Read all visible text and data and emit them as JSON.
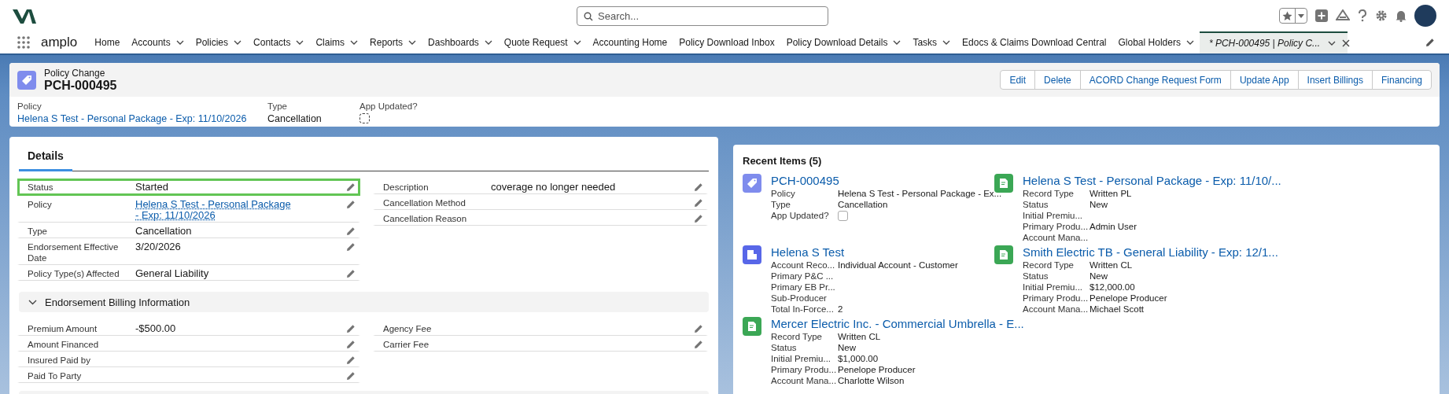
{
  "global_header": {
    "search": {
      "placeholder": "Search..."
    }
  },
  "nav": {
    "app_name": "amplo",
    "items": [
      {
        "label": "Home",
        "has_menu": false
      },
      {
        "label": "Accounts",
        "has_menu": true
      },
      {
        "label": "Policies",
        "has_menu": true
      },
      {
        "label": "Contacts",
        "has_menu": true
      },
      {
        "label": "Claims",
        "has_menu": true
      },
      {
        "label": "Reports",
        "has_menu": true
      },
      {
        "label": "Dashboards",
        "has_menu": true
      },
      {
        "label": "Quote Request",
        "has_menu": true
      },
      {
        "label": "Accounting Home",
        "has_menu": false
      },
      {
        "label": "Policy Download Inbox",
        "has_menu": false
      },
      {
        "label": "Policy Download Details",
        "has_menu": true
      },
      {
        "label": "Tasks",
        "has_menu": true
      },
      {
        "label": "Edocs & Claims Download Central",
        "has_menu": false
      },
      {
        "label": "Global Holders",
        "has_menu": true
      }
    ],
    "open_tab": {
      "label": "* PCH-000495 | Policy C...",
      "selected": true
    }
  },
  "record": {
    "object": "Policy Change",
    "name": "PCH-000495",
    "actions": [
      "Edit",
      "Delete",
      "ACORD Change Request Form",
      "Update App",
      "Insert Billings",
      "Financing"
    ],
    "highlights": [
      {
        "label": "Policy",
        "kind": "link",
        "value": "Helena S Test - Personal Package - Exp: 11/10/2026"
      },
      {
        "label": "Type",
        "kind": "text",
        "value": "Cancellation"
      },
      {
        "label": "App Updated?",
        "kind": "checkbox",
        "checked": false
      }
    ]
  },
  "details": {
    "tabs": [
      {
        "label": "Details",
        "selected": true
      }
    ],
    "left": [
      {
        "label": "Status",
        "value": "Started",
        "kind": "text",
        "highlighted": true
      },
      {
        "label": "Policy",
        "value": "Helena S Test - Personal Package - Exp: 11/10/2026",
        "kind": "link",
        "highlighted": false
      },
      {
        "label": "Type",
        "value": "Cancellation",
        "kind": "text",
        "highlighted": false
      },
      {
        "label": "Endorsement Effective Date",
        "value": "3/20/2026",
        "kind": "text",
        "highlighted": false
      },
      {
        "label": "Policy Type(s) Affected",
        "value": "General Liability",
        "kind": "text",
        "highlighted": false
      }
    ],
    "right": [
      {
        "label": "Description",
        "value": "coverage no longer needed",
        "kind": "text",
        "highlighted": false
      },
      {
        "label": "Cancellation Method",
        "highlighted": false
      },
      {
        "label": "Cancellation Reason",
        "highlighted": false
      }
    ],
    "sections": [
      {
        "title": "Endorsement Billing Information",
        "expanded": true,
        "left": [
          {
            "label": "Premium Amount",
            "value": "-$500.00",
            "kind": "text",
            "highlighted": false
          },
          {
            "label": "Amount Financed",
            "highlighted": false
          },
          {
            "label": "Insured Paid by",
            "highlighted": false
          },
          {
            "label": "Paid To Party",
            "highlighted": false
          }
        ],
        "right": [
          {
            "label": "Agency Fee",
            "highlighted": false
          },
          {
            "label": "Carrier Fee",
            "highlighted": false
          }
        ]
      }
    ]
  },
  "recent": {
    "title": "Recent Items (5)",
    "items": [
      {
        "kind": "policy_change",
        "color": "#7f8ced",
        "title": "PCH-000495",
        "fields": [
          {
            "label": "Policy",
            "value": "Helena S Test - Personal Package - Ex..."
          },
          {
            "label": "Type",
            "value": "Cancellation"
          },
          {
            "label": "App Updated?",
            "kind": "checkbox",
            "checked": false
          }
        ]
      },
      {
        "kind": "policy",
        "color": "#3ba755",
        "title": "Helena S Test - Personal Package - Exp: 11/10/...",
        "fields": [
          {
            "label": "Record Type",
            "value": "Written PL"
          },
          {
            "label": "Status",
            "value": "New"
          },
          {
            "label": "Initial Premiu..."
          },
          {
            "label": "Primary Produ...",
            "value": "Admin User"
          },
          {
            "label": "Account Mana..."
          }
        ]
      },
      {
        "kind": "account",
        "color": "#5867e8",
        "title": "Helena S Test",
        "fields": [
          {
            "label": "Account Reco...",
            "value": "Individual Account - Customer"
          },
          {
            "label": "Primary P&C ..."
          },
          {
            "label": "Primary EB Pr..."
          },
          {
            "label": "Sub-Producer"
          },
          {
            "label": "Total In-Force...",
            "value": "2"
          }
        ]
      },
      {
        "kind": "policy",
        "color": "#3ba755",
        "title": "Smith Electric TB - General Liability - Exp: 12/1...",
        "fields": [
          {
            "label": "Record Type",
            "value": "Written CL"
          },
          {
            "label": "Status",
            "value": "New"
          },
          {
            "label": "Initial Premiu...",
            "value": "$12,000.00"
          },
          {
            "label": "Primary Produ...",
            "value": "Penelope Producer"
          },
          {
            "label": "Account Mana...",
            "value": "Michael Scott"
          }
        ]
      },
      {
        "kind": "policy",
        "color": "#3ba755",
        "title": "Mercer Electric Inc. - Commercial Umbrella - E...",
        "fields": [
          {
            "label": "Record Type",
            "value": "Written CL"
          },
          {
            "label": "Status",
            "value": "New"
          },
          {
            "label": "Initial Premiu...",
            "value": "$1,000.00"
          },
          {
            "label": "Primary Produ...",
            "value": "Penelope Producer"
          },
          {
            "label": "Account Mana...",
            "value": "Charlotte Wilson"
          }
        ]
      }
    ]
  }
}
